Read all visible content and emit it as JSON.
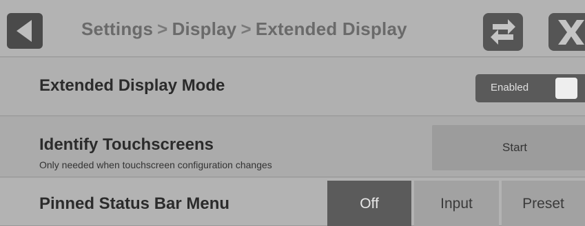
{
  "header": {
    "breadcrumb": [
      "Settings",
      "Display",
      "Extended Display"
    ],
    "separator": ">"
  },
  "settings": {
    "extended_display_mode": {
      "label": "Extended Display Mode",
      "toggle_label": "Enabled",
      "toggle_on": true
    },
    "identify_touchscreens": {
      "label": "Identify Touchscreens",
      "subtitle": "Only needed when touchscreen configuration changes",
      "button_label": "Start"
    },
    "pinned_status_bar_menu": {
      "label": "Pinned Status Bar Menu",
      "options": [
        "Off",
        "Input",
        "Preset"
      ],
      "selected": "Off"
    }
  },
  "icons": {
    "back": "back-arrow-icon",
    "swap": "swap-arrows-icon",
    "close": "close-x-icon"
  },
  "colors": {
    "background": "#a7a7a7",
    "selected_segment": "#5b5b5b",
    "icon_button": "#555555"
  }
}
